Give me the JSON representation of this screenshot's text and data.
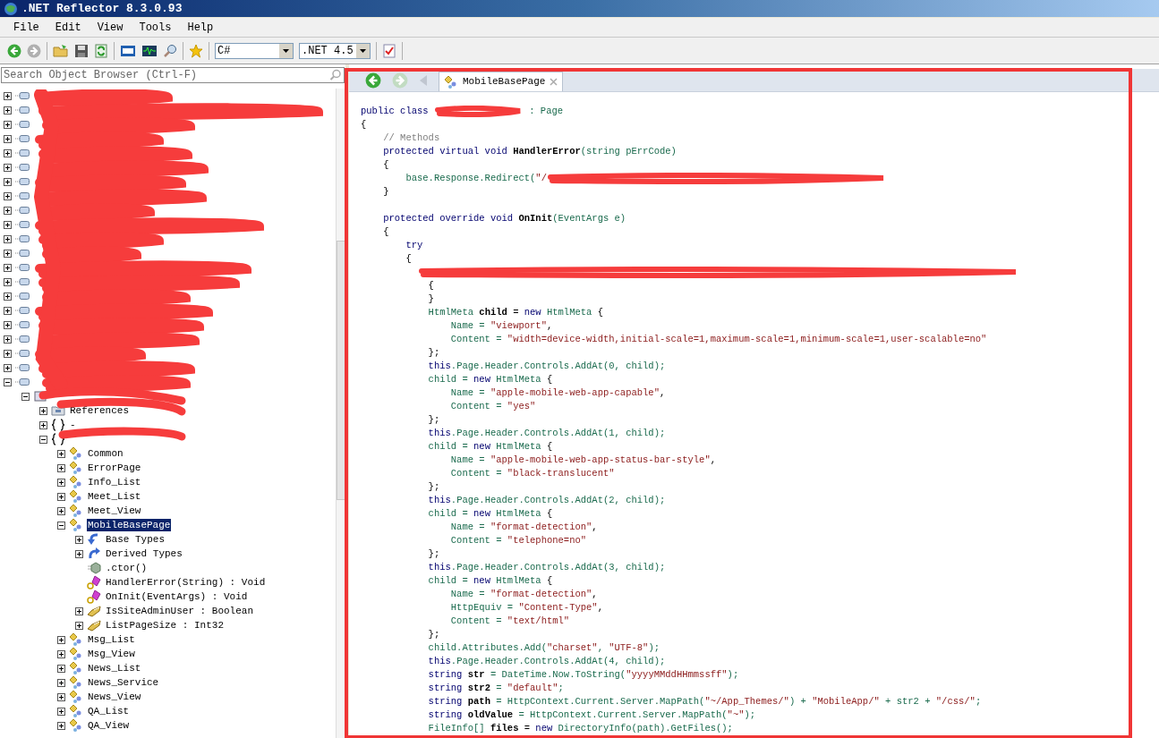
{
  "window": {
    "title": ".NET Reflector 8.3.0.93"
  },
  "menu": [
    "File",
    "Edit",
    "View",
    "Tools",
    "Help"
  ],
  "toolbar": {
    "language": "C#",
    "framework": ".NET 4.5"
  },
  "search": {
    "placeholder": "Search Object Browser (Ctrl-F)"
  },
  "tree": [
    {
      "kind": "assembly",
      "expanded": false
    },
    {
      "kind": "assembly",
      "expanded": false
    },
    {
      "kind": "assembly",
      "expanded": false
    },
    {
      "kind": "assembly",
      "expanded": false
    },
    {
      "kind": "assembly",
      "expanded": false
    },
    {
      "kind": "assembly",
      "expanded": false
    },
    {
      "kind": "assembly",
      "expanded": false
    },
    {
      "kind": "assembly",
      "expanded": false
    },
    {
      "kind": "assembly",
      "expanded": false
    },
    {
      "kind": "assembly",
      "expanded": false
    },
    {
      "kind": "assembly",
      "expanded": false
    },
    {
      "kind": "assembly",
      "expanded": false
    },
    {
      "kind": "assembly",
      "expanded": false
    },
    {
      "kind": "assembly",
      "expanded": false
    },
    {
      "kind": "assembly",
      "expanded": false
    },
    {
      "kind": "assembly",
      "expanded": false
    },
    {
      "kind": "assembly",
      "expanded": false
    },
    {
      "kind": "assembly",
      "expanded": false
    },
    {
      "kind": "assembly",
      "expanded": false
    },
    {
      "kind": "assembly",
      "expanded": false
    },
    {
      "kind": "assembly",
      "expanded": true,
      "children": [
        {
          "kind": "module",
          "expanded": true,
          "children": [
            {
              "kind": "references",
              "label": "References",
              "expanded": false,
              "selected": false
            },
            {
              "kind": "namespace",
              "label": "-",
              "expanded": false,
              "selected": false
            },
            {
              "kind": "namespace",
              "expanded": true,
              "children": [
                {
                  "kind": "class",
                  "label": "Common",
                  "expanded": false,
                  "selected": false
                },
                {
                  "kind": "class",
                  "label": "ErrorPage",
                  "expanded": false,
                  "selected": false
                },
                {
                  "kind": "class",
                  "label": "Info_List",
                  "expanded": false,
                  "selected": false
                },
                {
                  "kind": "class",
                  "label": "Meet_List",
                  "expanded": false,
                  "selected": false
                },
                {
                  "kind": "class",
                  "label": "Meet_View",
                  "expanded": false,
                  "selected": false
                },
                {
                  "kind": "class",
                  "label": "MobileBasePage",
                  "expanded": true,
                  "selected": true,
                  "children": [
                    {
                      "kind": "base-types",
                      "label": "Base Types",
                      "expanded": false,
                      "selected": false
                    },
                    {
                      "kind": "derived-types",
                      "label": "Derived Types",
                      "expanded": false,
                      "selected": false
                    },
                    {
                      "kind": "constructor",
                      "label": ".ctor()",
                      "selected": false
                    },
                    {
                      "kind": "method",
                      "label": "HandlerError(String) : Void",
                      "selected": false
                    },
                    {
                      "kind": "method",
                      "label": "OnInit(EventArgs) : Void",
                      "selected": false
                    },
                    {
                      "kind": "property",
                      "label": "IsSiteAdminUser : Boolean",
                      "expanded": false,
                      "selected": false
                    },
                    {
                      "kind": "property",
                      "label": "ListPageSize : Int32",
                      "expanded": false,
                      "selected": false
                    }
                  ]
                },
                {
                  "kind": "class",
                  "label": "Msg_List",
                  "expanded": false,
                  "selected": false
                },
                {
                  "kind": "class",
                  "label": "Msg_View",
                  "expanded": false,
                  "selected": false
                },
                {
                  "kind": "class",
                  "label": "News_List",
                  "expanded": false,
                  "selected": false
                },
                {
                  "kind": "class",
                  "label": "News_Service",
                  "expanded": false,
                  "selected": false
                },
                {
                  "kind": "class",
                  "label": "News_View",
                  "expanded": false,
                  "selected": false
                },
                {
                  "kind": "class",
                  "label": "QA_List",
                  "expanded": false,
                  "selected": false
                },
                {
                  "kind": "class",
                  "label": "QA_View",
                  "expanded": false,
                  "selected": false
                }
              ]
            }
          ]
        }
      ]
    }
  ],
  "tab": {
    "label": "MobileBasePage"
  },
  "code": [
    {
      "kind": "code",
      "parts": [
        {
          "kind": "keyword",
          "text": "public class "
        },
        {
          "kind": "scribble"
        },
        {
          "kind": "name",
          "text": " : Page"
        }
      ]
    },
    {
      "kind": "code",
      "parts": [
        {
          "kind": "plain",
          "text": "{"
        }
      ]
    },
    {
      "kind": "code",
      "parts": [
        {
          "kind": "comment",
          "text": "    // Methods"
        }
      ]
    },
    {
      "kind": "code",
      "parts": [
        {
          "kind": "keyword",
          "text": "    protected virtual void "
        },
        {
          "kind": "bold",
          "text": "HandlerError"
        },
        {
          "kind": "name",
          "text": "(string pErrCode)"
        }
      ]
    },
    {
      "kind": "code",
      "parts": [
        {
          "kind": "plain",
          "text": "    {"
        }
      ]
    },
    {
      "kind": "code",
      "parts": [
        {
          "kind": "name",
          "text": "        base.Response.Redirect("
        },
        {
          "kind": "string",
          "text": "\"/"
        },
        {
          "kind": "scribble"
        }
      ]
    },
    {
      "kind": "code",
      "parts": [
        {
          "kind": "plain",
          "text": "    }"
        }
      ]
    },
    {
      "kind": "blank"
    },
    {
      "kind": "code",
      "parts": [
        {
          "kind": "keyword",
          "text": "    protected override void "
        },
        {
          "kind": "bold",
          "text": "OnInit"
        },
        {
          "kind": "name",
          "text": "(EventArgs e)"
        }
      ]
    },
    {
      "kind": "code",
      "parts": [
        {
          "kind": "plain",
          "text": "    {"
        }
      ]
    },
    {
      "kind": "code",
      "parts": [
        {
          "kind": "keyword",
          "text": "        try"
        }
      ]
    },
    {
      "kind": "code",
      "parts": [
        {
          "kind": "plain",
          "text": "        {"
        }
      ]
    },
    {
      "kind": "code",
      "parts": [
        {
          "kind": "scribble"
        }
      ]
    },
    {
      "kind": "code",
      "parts": [
        {
          "kind": "plain",
          "text": "            {"
        }
      ]
    },
    {
      "kind": "code",
      "parts": [
        {
          "kind": "plain",
          "text": "            }"
        }
      ]
    },
    {
      "kind": "code",
      "parts": [
        {
          "kind": "name",
          "text": "            HtmlMeta "
        },
        {
          "kind": "bold",
          "text": "child"
        },
        {
          "kind": "plain",
          "text": " = "
        },
        {
          "kind": "keyword",
          "text": "new"
        },
        {
          "kind": "name",
          "text": " HtmlMeta "
        },
        {
          "kind": "plain",
          "text": "{"
        }
      ]
    },
    {
      "kind": "code",
      "parts": [
        {
          "kind": "name",
          "text": "                Name = "
        },
        {
          "kind": "string",
          "text": "\"viewport\""
        },
        {
          "kind": "plain",
          "text": ","
        }
      ]
    },
    {
      "kind": "code",
      "parts": [
        {
          "kind": "name",
          "text": "                Content = "
        },
        {
          "kind": "string",
          "text": "\"width=device-width,initial-scale=1,maximum-scale=1,minimum-scale=1,user-scalable=no\""
        }
      ]
    },
    {
      "kind": "code",
      "parts": [
        {
          "kind": "plain",
          "text": "            };"
        }
      ]
    },
    {
      "kind": "code",
      "parts": [
        {
          "kind": "keyword",
          "text": "            this"
        },
        {
          "kind": "name",
          "text": ".Page.Header.Controls.AddAt(0, child);"
        }
      ]
    },
    {
      "kind": "code",
      "parts": [
        {
          "kind": "name",
          "text": "            child = "
        },
        {
          "kind": "keyword",
          "text": "new"
        },
        {
          "kind": "name",
          "text": " HtmlMeta "
        },
        {
          "kind": "plain",
          "text": "{"
        }
      ]
    },
    {
      "kind": "code",
      "parts": [
        {
          "kind": "name",
          "text": "                Name = "
        },
        {
          "kind": "string",
          "text": "\"apple-mobile-web-app-capable\""
        },
        {
          "kind": "plain",
          "text": ","
        }
      ]
    },
    {
      "kind": "code",
      "parts": [
        {
          "kind": "name",
          "text": "                Content = "
        },
        {
          "kind": "string",
          "text": "\"yes\""
        }
      ]
    },
    {
      "kind": "code",
      "parts": [
        {
          "kind": "plain",
          "text": "            };"
        }
      ]
    },
    {
      "kind": "code",
      "parts": [
        {
          "kind": "keyword",
          "text": "            this"
        },
        {
          "kind": "name",
          "text": ".Page.Header.Controls.AddAt(1, child);"
        }
      ]
    },
    {
      "kind": "code",
      "parts": [
        {
          "kind": "name",
          "text": "            child = "
        },
        {
          "kind": "keyword",
          "text": "new"
        },
        {
          "kind": "name",
          "text": " HtmlMeta "
        },
        {
          "kind": "plain",
          "text": "{"
        }
      ]
    },
    {
      "kind": "code",
      "parts": [
        {
          "kind": "name",
          "text": "                Name = "
        },
        {
          "kind": "string",
          "text": "\"apple-mobile-web-app-status-bar-style\""
        },
        {
          "kind": "plain",
          "text": ","
        }
      ]
    },
    {
      "kind": "code",
      "parts": [
        {
          "kind": "name",
          "text": "                Content = "
        },
        {
          "kind": "string",
          "text": "\"black-translucent\""
        }
      ]
    },
    {
      "kind": "code",
      "parts": [
        {
          "kind": "plain",
          "text": "            };"
        }
      ]
    },
    {
      "kind": "code",
      "parts": [
        {
          "kind": "keyword",
          "text": "            this"
        },
        {
          "kind": "name",
          "text": ".Page.Header.Controls.AddAt(2, child);"
        }
      ]
    },
    {
      "kind": "code",
      "parts": [
        {
          "kind": "name",
          "text": "            child = "
        },
        {
          "kind": "keyword",
          "text": "new"
        },
        {
          "kind": "name",
          "text": " HtmlMeta "
        },
        {
          "kind": "plain",
          "text": "{"
        }
      ]
    },
    {
      "kind": "code",
      "parts": [
        {
          "kind": "name",
          "text": "                Name = "
        },
        {
          "kind": "string",
          "text": "\"format-detection\""
        },
        {
          "kind": "plain",
          "text": ","
        }
      ]
    },
    {
      "kind": "code",
      "parts": [
        {
          "kind": "name",
          "text": "                Content = "
        },
        {
          "kind": "string",
          "text": "\"telephone=no\""
        }
      ]
    },
    {
      "kind": "code",
      "parts": [
        {
          "kind": "plain",
          "text": "            };"
        }
      ]
    },
    {
      "kind": "code",
      "parts": [
        {
          "kind": "keyword",
          "text": "            this"
        },
        {
          "kind": "name",
          "text": ".Page.Header.Controls.AddAt(3, child);"
        }
      ]
    },
    {
      "kind": "code",
      "parts": [
        {
          "kind": "name",
          "text": "            child = "
        },
        {
          "kind": "keyword",
          "text": "new"
        },
        {
          "kind": "name",
          "text": " HtmlMeta "
        },
        {
          "kind": "plain",
          "text": "{"
        }
      ]
    },
    {
      "kind": "code",
      "parts": [
        {
          "kind": "name",
          "text": "                Name = "
        },
        {
          "kind": "string",
          "text": "\"format-detection\""
        },
        {
          "kind": "plain",
          "text": ","
        }
      ]
    },
    {
      "kind": "code",
      "parts": [
        {
          "kind": "name",
          "text": "                HttpEquiv = "
        },
        {
          "kind": "string",
          "text": "\"Content-Type\""
        },
        {
          "kind": "plain",
          "text": ","
        }
      ]
    },
    {
      "kind": "code",
      "parts": [
        {
          "kind": "name",
          "text": "                Content = "
        },
        {
          "kind": "string",
          "text": "\"text/html\""
        }
      ]
    },
    {
      "kind": "code",
      "parts": [
        {
          "kind": "plain",
          "text": "            };"
        }
      ]
    },
    {
      "kind": "code",
      "parts": [
        {
          "kind": "name",
          "text": "            child.Attributes.Add("
        },
        {
          "kind": "string",
          "text": "\"charset\""
        },
        {
          "kind": "name",
          "text": ", "
        },
        {
          "kind": "string",
          "text": "\"UTF-8\""
        },
        {
          "kind": "name",
          "text": ");"
        }
      ]
    },
    {
      "kind": "code",
      "parts": [
        {
          "kind": "keyword",
          "text": "            this"
        },
        {
          "kind": "name",
          "text": ".Page.Header.Controls.AddAt(4, child);"
        }
      ]
    },
    {
      "kind": "code",
      "parts": [
        {
          "kind": "keyword",
          "text": "            string "
        },
        {
          "kind": "bold",
          "text": "str"
        },
        {
          "kind": "name",
          "text": " = DateTime.Now.ToString("
        },
        {
          "kind": "string",
          "text": "\"yyyyMMddHHmmssff\""
        },
        {
          "kind": "name",
          "text": ");"
        }
      ]
    },
    {
      "kind": "code",
      "parts": [
        {
          "kind": "keyword",
          "text": "            string "
        },
        {
          "kind": "bold",
          "text": "str2"
        },
        {
          "kind": "name",
          "text": " = "
        },
        {
          "kind": "string",
          "text": "\"default\""
        },
        {
          "kind": "name",
          "text": ";"
        }
      ]
    },
    {
      "kind": "code",
      "parts": [
        {
          "kind": "keyword",
          "text": "            string "
        },
        {
          "kind": "bold",
          "text": "path"
        },
        {
          "kind": "name",
          "text": " = HttpContext.Current.Server.MapPath("
        },
        {
          "kind": "string",
          "text": "\"~/App_Themes/\""
        },
        {
          "kind": "name",
          "text": ") + "
        },
        {
          "kind": "string",
          "text": "\"MobileApp/\""
        },
        {
          "kind": "name",
          "text": " + str2 + "
        },
        {
          "kind": "string",
          "text": "\"/css/\""
        },
        {
          "kind": "name",
          "text": ";"
        }
      ]
    },
    {
      "kind": "code",
      "parts": [
        {
          "kind": "keyword",
          "text": "            string "
        },
        {
          "kind": "bold",
          "text": "oldValue"
        },
        {
          "kind": "name",
          "text": " = HttpContext.Current.Server.MapPath("
        },
        {
          "kind": "string",
          "text": "\"~\""
        },
        {
          "kind": "name",
          "text": ");"
        }
      ]
    },
    {
      "kind": "code",
      "parts": [
        {
          "kind": "name",
          "text": "            FileInfo[] "
        },
        {
          "kind": "bold",
          "text": "files"
        },
        {
          "kind": "plain",
          "text": " = "
        },
        {
          "kind": "keyword",
          "text": "new"
        },
        {
          "kind": "name",
          "text": " DirectoryInfo(path).GetFiles();"
        }
      ]
    }
  ]
}
